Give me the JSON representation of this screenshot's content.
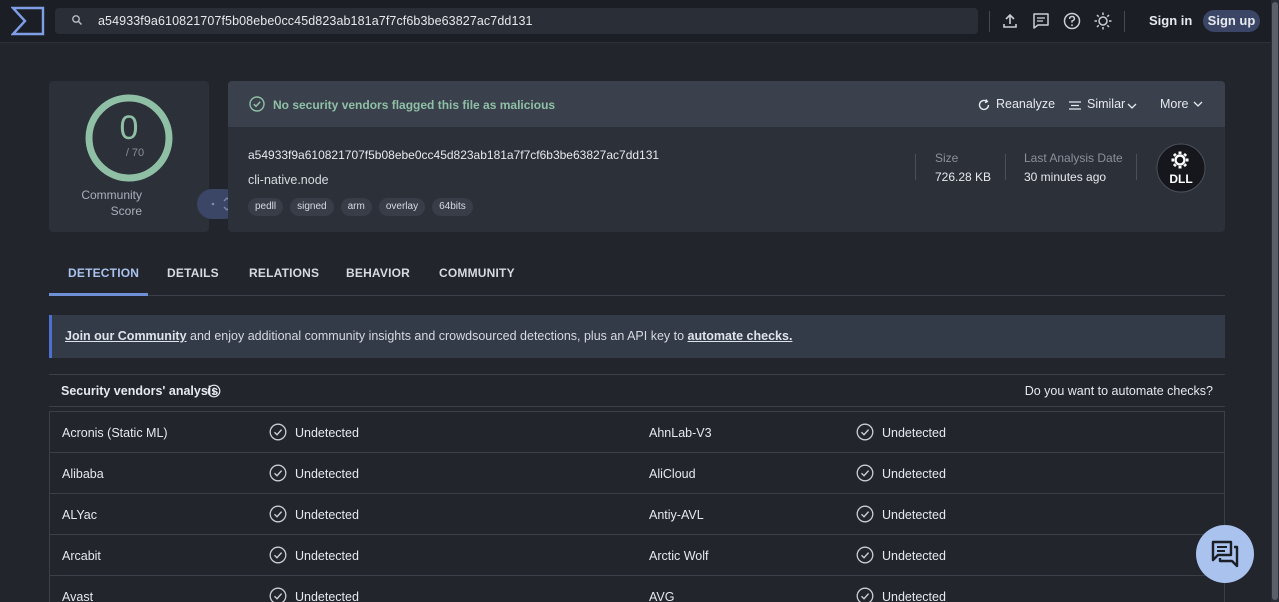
{
  "header": {
    "search_value": "a54933f9a610821707f5b08ebe0cc45d823ab181a7f7cf6b3be63827ac7dd131",
    "icons": [
      "upload-icon",
      "comment-icon",
      "help-icon",
      "theme-icon"
    ],
    "sign_in": "Sign in",
    "sign_up": "Sign up"
  },
  "score": {
    "detections": "0",
    "total": "/ 70",
    "community_label_line1": "Community",
    "community_label_line2": "Score"
  },
  "summary": {
    "status_text": "No security vendors flagged this file as malicious",
    "reanalyze": "Reanalyze",
    "similar": "Similar",
    "more": "More",
    "hash": "a54933f9a610821707f5b08ebe0cc45d823ab181a7f7cf6b3be63827ac7dd131",
    "file_name": "cli-native.node",
    "tags": [
      "pedll",
      "signed",
      "arm",
      "overlay",
      "64bits"
    ],
    "size_label": "Size",
    "size_value": "726.28 KB",
    "date_label": "Last Analysis Date",
    "date_value": "30 minutes ago",
    "file_type": "DLL"
  },
  "tabs": [
    "DETECTION",
    "DETAILS",
    "RELATIONS",
    "BEHAVIOR",
    "COMMUNITY"
  ],
  "banner": {
    "link1": "Join our Community",
    "text1": " and enjoy additional community insights and crowdsourced detections, plus an API key to ",
    "link2": "automate checks."
  },
  "vendors": {
    "title": "Security vendors' analysis",
    "automate_question": "Do you want to automate checks?",
    "rows": [
      {
        "left": "Acronis (Static ML)",
        "left_status": "Undetected",
        "right": "AhnLab-V3",
        "right_status": "Undetected"
      },
      {
        "left": "Alibaba",
        "left_status": "Undetected",
        "right": "AliCloud",
        "right_status": "Undetected"
      },
      {
        "left": "ALYac",
        "left_status": "Undetected",
        "right": "Antiy-AVL",
        "right_status": "Undetected"
      },
      {
        "left": "Arcabit",
        "left_status": "Undetected",
        "right": "Arctic Wolf",
        "right_status": "Undetected"
      },
      {
        "left": "Avast",
        "left_status": "Undetected",
        "right": "AVG",
        "right_status": "Undetected"
      }
    ]
  },
  "colors": {
    "accent_green": "#8fc0a6",
    "accent_blue": "#a9c2ee",
    "banner_border": "#4c70d0"
  }
}
